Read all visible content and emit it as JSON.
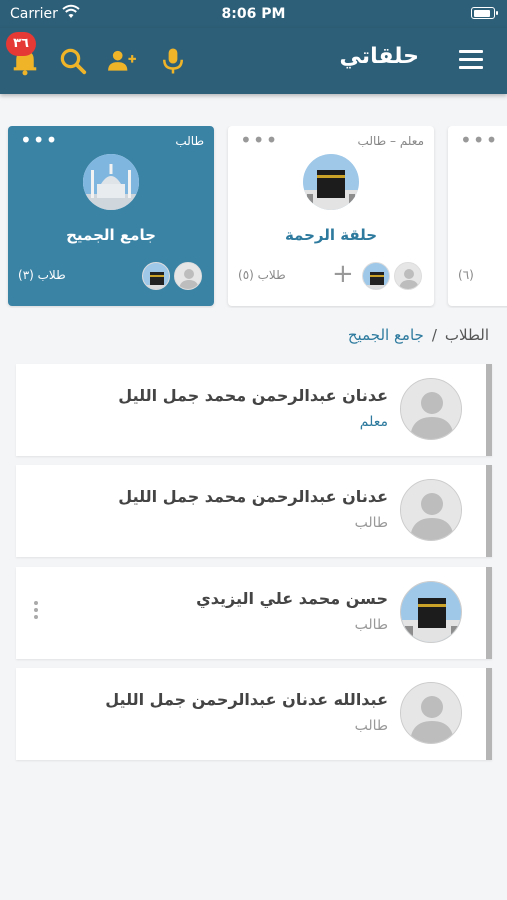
{
  "status_bar": {
    "carrier": "Carrier",
    "time": "8:06 PM"
  },
  "header": {
    "title": "حلقاتي",
    "notification_count": "٣٦"
  },
  "circles": [
    {
      "role": "طالب",
      "name": "جامع الجميح",
      "count": "طلاب (٣)",
      "active": true
    },
    {
      "role": "معلم – طالب",
      "name": "حلقة الرحمة",
      "count": "طلاب (٥)",
      "active": false
    },
    {
      "count": "(٦)"
    }
  ],
  "breadcrumb": {
    "root": "الطلاب",
    "separator": "/",
    "current": "جامع الجميح"
  },
  "members": [
    {
      "name": "عدنان عبدالرحمن محمد جمل الليل",
      "role": "معلم"
    },
    {
      "name": "عدنان عبدالرحمن محمد جمل الليل",
      "role": "طالب"
    },
    {
      "name": "حسن محمد علي اليزيدي",
      "role": "طالب"
    },
    {
      "name": "عبدالله عدنان عبدالرحمن جمل الليل",
      "role": "طالب"
    }
  ],
  "icons": [
    "menu-icon",
    "mic-icon",
    "add-user-icon",
    "search-icon",
    "bell-icon",
    "more-icon",
    "plus-icon",
    "kebab-icon"
  ],
  "colors": {
    "primary": "#2d5f78",
    "accent": "#3b83a5",
    "link": "#2d7a9e",
    "badge": "#e53935",
    "icon": "#f0b429"
  }
}
